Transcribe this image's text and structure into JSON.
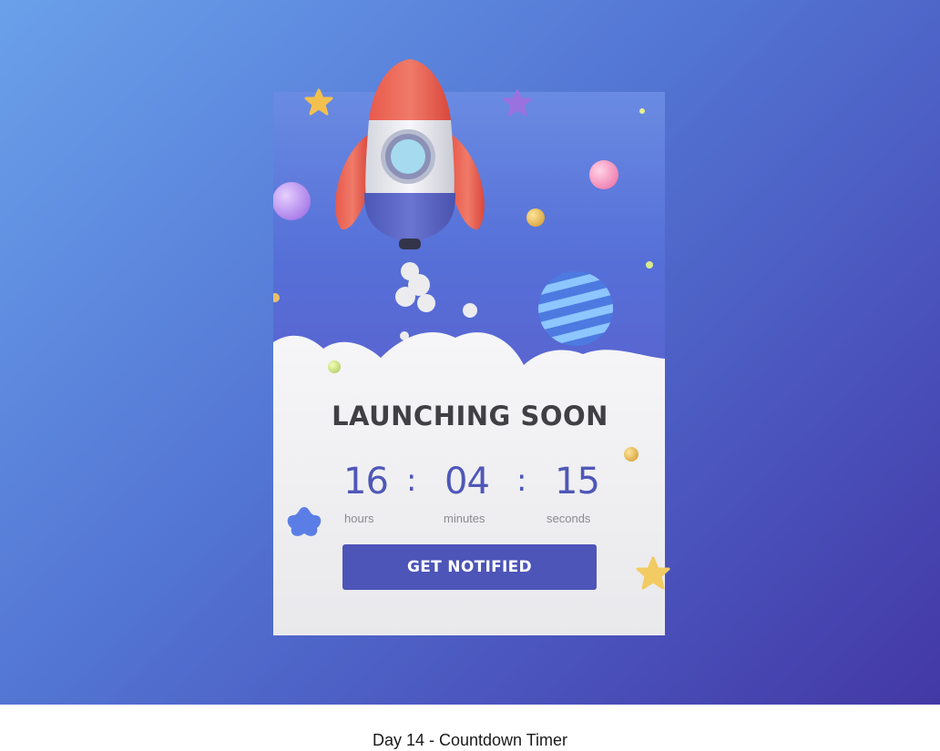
{
  "card": {
    "title": "LAUNCHING SOON",
    "countdown": [
      {
        "value": "16",
        "unit": "hours"
      },
      {
        "value": "04",
        "unit": "minutes"
      },
      {
        "value": "15",
        "unit": "seconds"
      }
    ],
    "separator": ":",
    "cta_label": "GET NOTIFIED"
  },
  "caption": "Day 14 - Countdown Timer",
  "colors": {
    "accent": "#4d55b8",
    "headline": "#3f3f44",
    "background_start": "#6aa0ea",
    "background_end": "#4338a6"
  },
  "illustration": {
    "icons": [
      "rocket-icon",
      "planet-icon",
      "cloud-icon",
      "star-icon"
    ]
  }
}
